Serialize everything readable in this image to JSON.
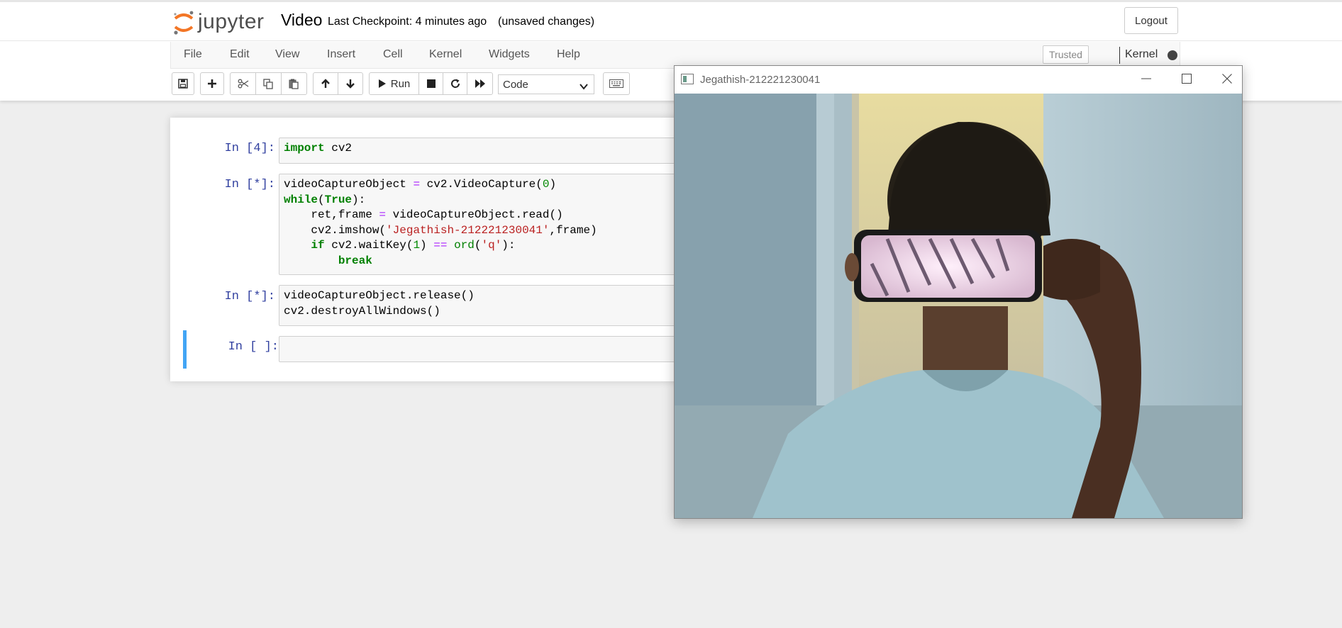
{
  "header": {
    "logo_text": "jupyter",
    "notebook_name": "Video",
    "checkpoint": "Last Checkpoint: 4 minutes ago",
    "autosave": "(unsaved changes)",
    "logout_label": "Logout"
  },
  "menubar": {
    "items": [
      "File",
      "Edit",
      "View",
      "Insert",
      "Cell",
      "Kernel",
      "Widgets",
      "Help"
    ],
    "trusted_label": "Trusted",
    "kernel_label": "Kernel"
  },
  "toolbar": {
    "run_label": "Run",
    "cell_type": "Code"
  },
  "cells": [
    {
      "prompt": "In [4]:"
    },
    {
      "prompt": "In [*]:"
    },
    {
      "prompt": "In [*]:"
    },
    {
      "prompt": "In [ ]:"
    }
  ],
  "cv_window": {
    "title": "Jegathish-212221230041"
  },
  "colors": {
    "accent": "#f37626",
    "selected_cell": "#42a5f5",
    "prompt": "#303f9f"
  }
}
